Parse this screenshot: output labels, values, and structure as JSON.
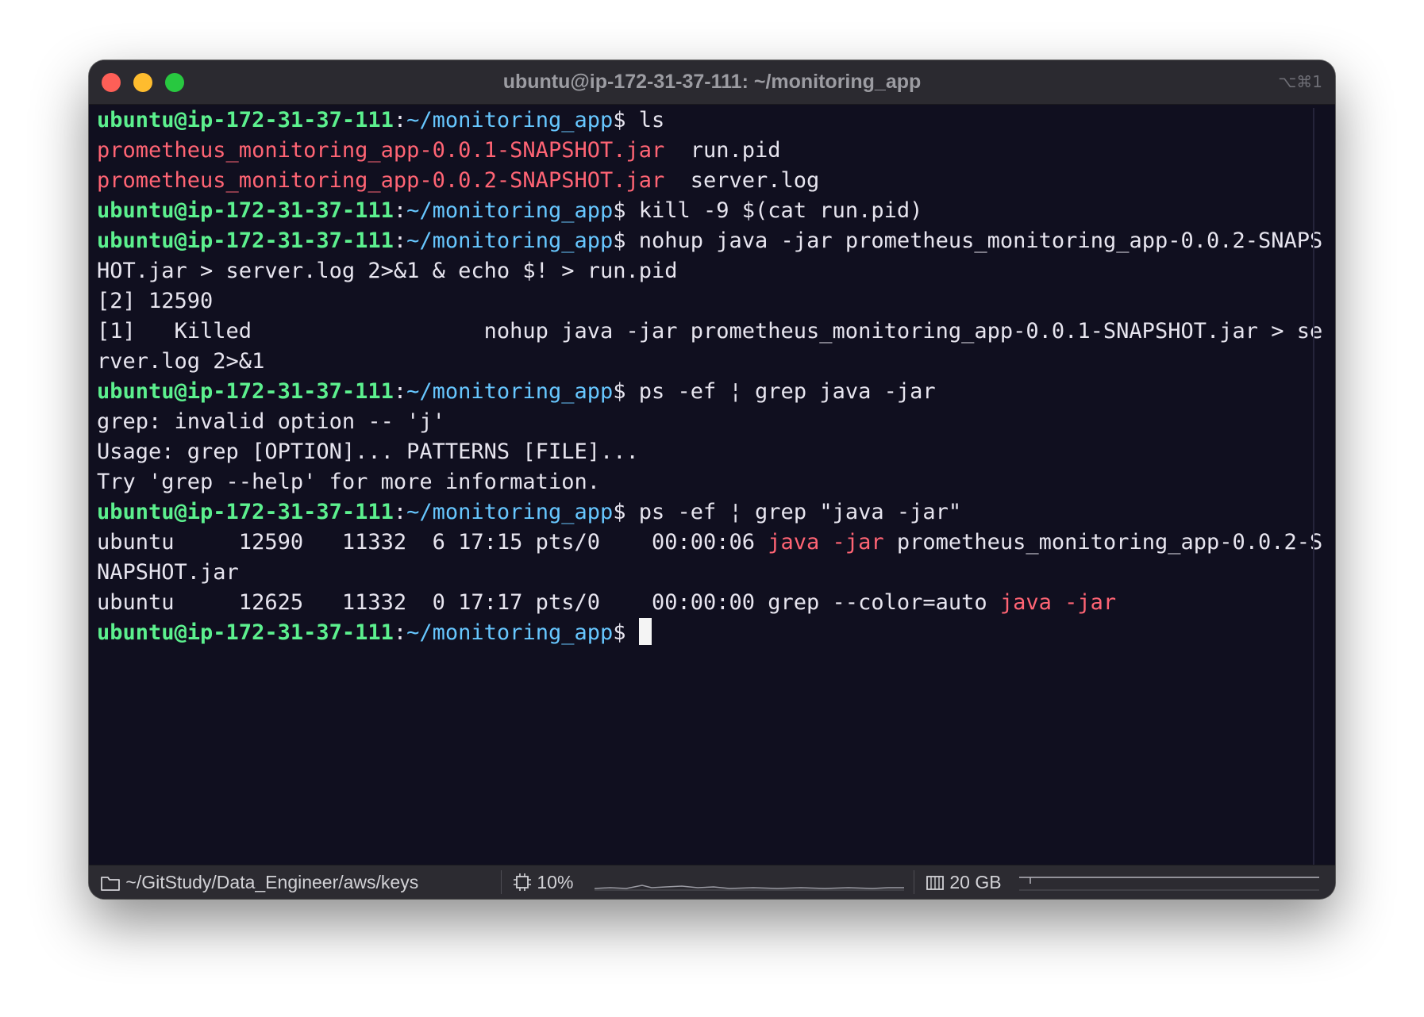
{
  "window": {
    "title": "ubuntu@ip-172-31-37-111: ~/monitoring_app",
    "shortcut": "⌥⌘1"
  },
  "terminal": {
    "prompt_user": "ubuntu@ip-172-31-37-111",
    "prompt_path": "~/monitoring_app",
    "prompt_sep": ":",
    "prompt_symbol": "$ ",
    "lines": [
      {
        "cmd": "ls"
      },
      {
        "jar": "prometheus_monitoring_app-0.0.1-SNAPSHOT.jar",
        "rest": "  run.pid"
      },
      {
        "jar": "prometheus_monitoring_app-0.0.2-SNAPSHOT.jar",
        "rest": "  server.log"
      },
      {
        "cmd": "kill -9 $(cat run.pid)"
      },
      {
        "cmd": "nohup java -jar prometheus_monitoring_app-0.0.2-SNAPS"
      },
      {
        "text": "HOT.jar > server.log 2>&1 & echo $! > run.pid"
      },
      {
        "text": "[2] 12590"
      },
      {
        "text": "[1]   Killed                  nohup java -jar prometheus_monitoring_app-0.0.1-SNAPSHOT.jar > se"
      },
      {
        "text": "rver.log 2>&1"
      },
      {
        "cmd": "ps -ef ¦ grep java -jar"
      },
      {
        "text": "grep: invalid option -- 'j'"
      },
      {
        "text": "Usage: grep [OPTION]... PATTERNS [FILE]..."
      },
      {
        "text": "Try 'grep --help' for more information."
      },
      {
        "cmd": "ps -ef ¦ grep \"java -jar\""
      },
      {
        "pre": "ubuntu     12590   11332  6 17:15 pts/0    00:00:06 ",
        "hl": "java -jar",
        "post": " prometheus_monitoring_app-0.0.2-S"
      },
      {
        "text": "NAPSHOT.jar"
      },
      {
        "pre": "ubuntu     12625   11332  0 17:17 pts/0    00:00:00 grep --color=auto ",
        "hl": "java -jar",
        "post": ""
      },
      {
        "cmd": ""
      }
    ]
  },
  "status": {
    "folder_icon": "folder-icon",
    "cwd": "~/GitStudy/Data_Engineer/aws/keys",
    "cpu_icon": "cpu-icon",
    "cpu": "10%",
    "mem_icon": "memory-icon",
    "mem": "20 GB"
  },
  "colors": {
    "prompt_user": "#5cf08e",
    "prompt_path": "#67c7ff",
    "highlight": "#ff6474",
    "background": "#100f1f"
  }
}
